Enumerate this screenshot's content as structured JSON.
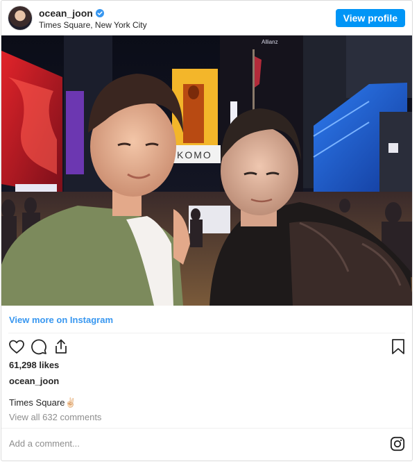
{
  "header": {
    "username": "ocean_joon",
    "location": "Times Square, New York City",
    "view_profile_label": "View profile"
  },
  "photo": {
    "billboard_text": "KOMO",
    "building_sign": "Allianz"
  },
  "view_more_label": "View more on Instagram",
  "likes": "61,298 likes",
  "owner": "ocean_joon",
  "caption": "Times Square✌🏻",
  "comments_link": "View all 632 comments",
  "comment_placeholder": "Add a comment...",
  "colors": {
    "accent": "#0095f6",
    "link": "#3897f0",
    "muted": "#8e8e8e"
  },
  "icons": {
    "like": "heart-icon",
    "comment": "comment-icon",
    "share": "share-icon",
    "save": "bookmark-icon",
    "brand": "instagram-icon",
    "verified": "verified-badge-icon"
  }
}
